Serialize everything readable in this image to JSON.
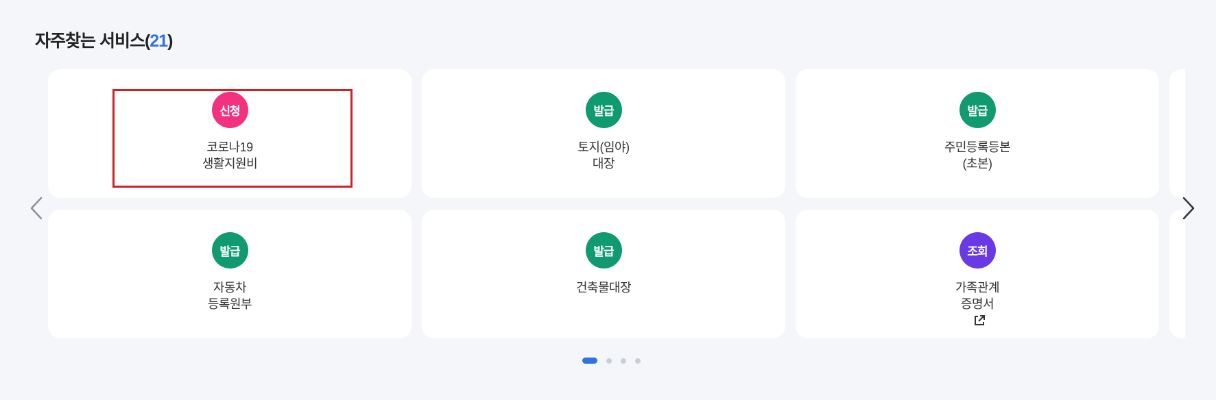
{
  "section": {
    "title": "자주찾는 서비스(",
    "count": "21",
    "close_paren": ")"
  },
  "colors": {
    "badge_apply": "#f2317f",
    "badge_issue": "#0f9a70",
    "badge_inquiry": "#6a39e6",
    "accent": "#2f74d9",
    "highlight_border": "#d41f25"
  },
  "services": [
    {
      "badge": "신청",
      "badge_color": "#f2317f",
      "lines": [
        "코로나19",
        "생활지원비"
      ],
      "external": false
    },
    {
      "badge": "발급",
      "badge_color": "#0f9a70",
      "lines": [
        "토지(임야)",
        "대장"
      ],
      "external": false
    },
    {
      "badge": "발급",
      "badge_color": "#0f9a70",
      "lines": [
        "주민등록등본",
        "(초본)"
      ],
      "external": false
    },
    {
      "badge": "발급",
      "badge_color": "#0f9a70",
      "lines": [
        "자동차",
        "등록원부"
      ],
      "external": false
    },
    {
      "badge": "발급",
      "badge_color": "#0f9a70",
      "lines": [
        "건축물대장"
      ],
      "external": false
    },
    {
      "badge": "조회",
      "badge_color": "#6a39e6",
      "lines": [
        "가족관계",
        "증명서"
      ],
      "external": true
    }
  ],
  "nav": {
    "prev_icon": "chevron-left-icon",
    "next_icon": "chevron-right-icon",
    "external_icon": "external-link-icon"
  },
  "pagination": {
    "pages": 4,
    "current": 1
  }
}
